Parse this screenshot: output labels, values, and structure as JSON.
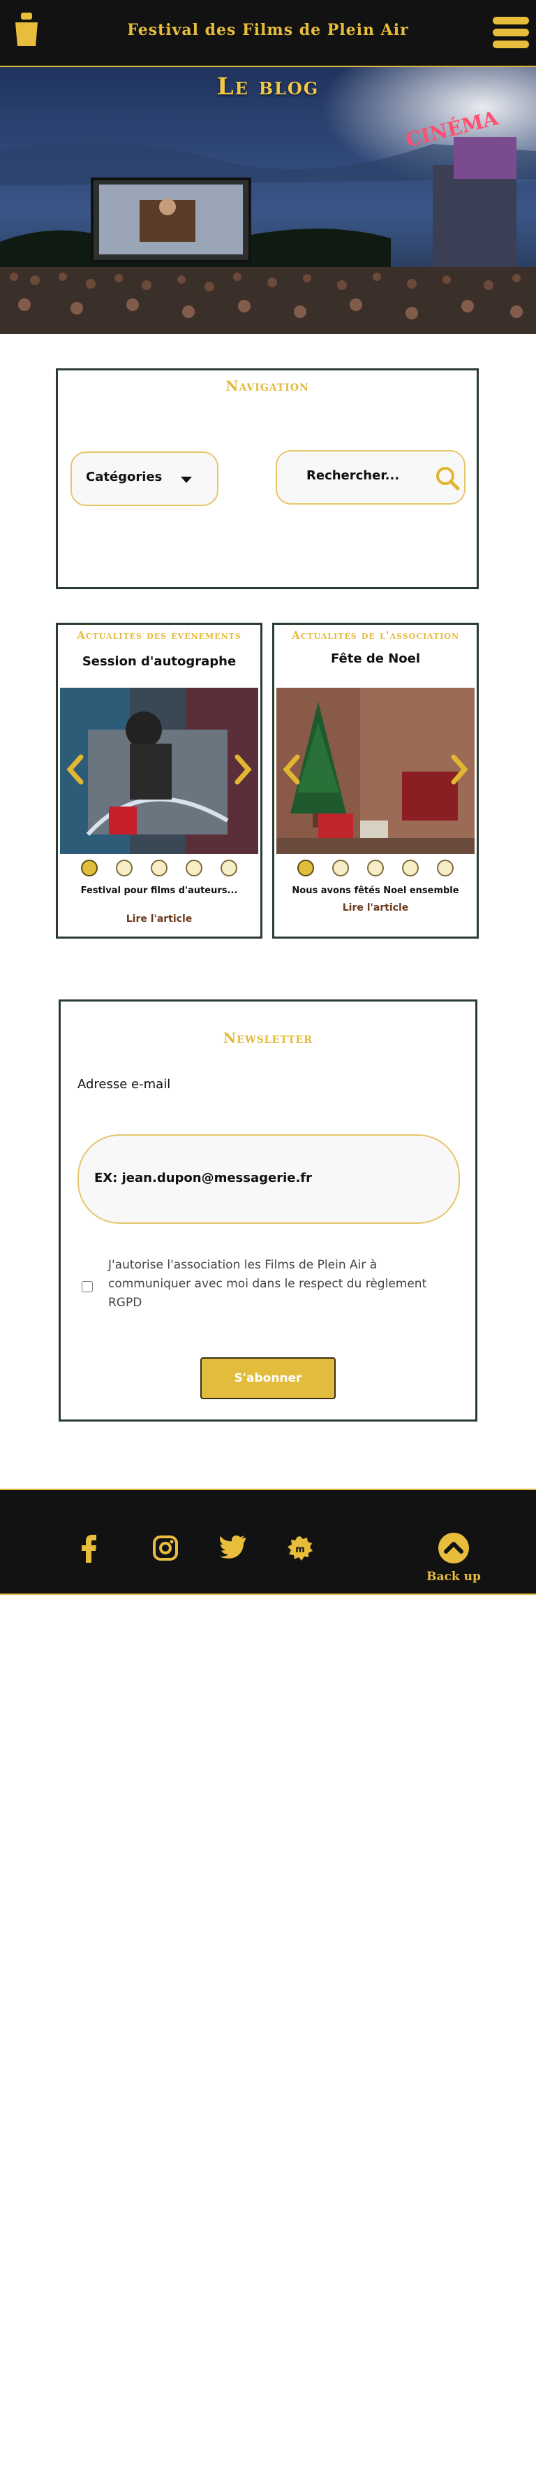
{
  "header": {
    "logo_icon": "popcorn-bucket-icon",
    "site_title": "Festival des Films de Plein Air",
    "menu_icon": "hamburger-menu-icon"
  },
  "hero": {
    "title": "Le blog",
    "sign_text": "CINÉMA"
  },
  "navigation": {
    "title": "Navigation",
    "categories_label": "Catégories",
    "categories_icon": "caret-down-icon",
    "search_placeholder": "Rechercher...",
    "search_icon": "search-icon"
  },
  "cards": [
    {
      "title": "Actualités des évènements",
      "subtitle": "Session d'autographe",
      "caption": "Festival pour films d'auteurs...",
      "link": "Lire l'article",
      "dots": 5,
      "active_dot": 0
    },
    {
      "title": "Actualités de l'association",
      "subtitle": "Fête de Noel",
      "caption": "Nous avons fêtés Noel ensemble",
      "link": "Lire l'article",
      "dots": 5,
      "active_dot": 0
    }
  ],
  "newsletter": {
    "title": "Newsletter",
    "email_label": "Adresse e-mail",
    "email_placeholder": "EX: jean.dupon@messagerie.fr",
    "consent_text": "J'autorise l'association les Films de Plein Air à communiquer avec moi dans le respect du règlement RGPD",
    "consent_checked": false,
    "subscribe_label": "S'abonner"
  },
  "footer": {
    "social_icons": [
      "facebook-icon",
      "instagram-icon",
      "twitter-icon",
      "messagerie-icon"
    ],
    "back_up_label": "Back up"
  },
  "colors": {
    "accent": "#e8bd3c",
    "dark": "#121212",
    "border": "#2a3c32",
    "link": "#6e3a1d"
  }
}
